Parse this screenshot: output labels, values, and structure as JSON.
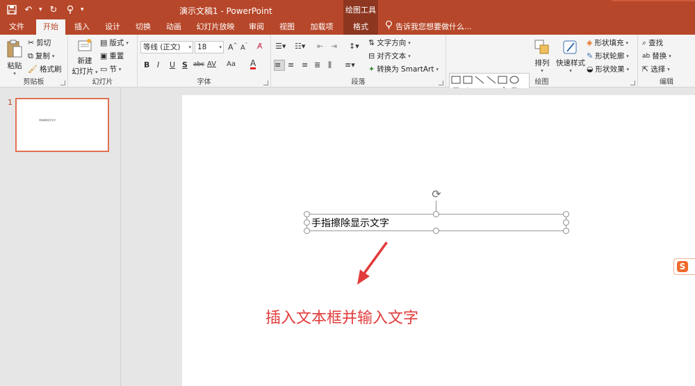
{
  "titlebar": {
    "doc_title": "演示文稿1 - PowerPoint",
    "context_title": "绘图工具",
    "qat": [
      "save-icon",
      "undo-icon",
      "redo-icon",
      "touch-mode-icon",
      "customize-icon"
    ]
  },
  "tabs": [
    {
      "label": "文件"
    },
    {
      "label": "开始"
    },
    {
      "label": "插入"
    },
    {
      "label": "设计"
    },
    {
      "label": "切换"
    },
    {
      "label": "动画"
    },
    {
      "label": "幻灯片放映"
    },
    {
      "label": "审阅"
    },
    {
      "label": "视图"
    },
    {
      "label": "加载项"
    },
    {
      "label": "格式"
    }
  ],
  "tellme": "告诉我您想要做什么...",
  "ribbon": {
    "clipboard": {
      "paste": "粘贴",
      "cut": "剪切",
      "copy": "复制",
      "format_painter": "格式刷",
      "label": "剪贴板"
    },
    "slides": {
      "new_slide_line1": "新建",
      "new_slide_line2": "幻灯片",
      "layout": "版式",
      "reset": "重置",
      "section": "节",
      "label": "幻灯片"
    },
    "font": {
      "font_name": "等线 (正文)",
      "font_size": "18",
      "label": "字体",
      "buttons": [
        "B",
        "I",
        "U",
        "S",
        "abc",
        "AV",
        "Aa",
        "A"
      ]
    },
    "paragraph": {
      "text_direction": "文字方向",
      "align_text": "对齐文本",
      "smartart": "转换为 SmartArt",
      "label": "段落"
    },
    "drawing": {
      "arrange": "排列",
      "quick_styles": "快速样式",
      "shape_fill": "形状填充",
      "shape_outline": "形状轮廓",
      "shape_effects": "形状效果",
      "label": "绘图"
    },
    "editing": {
      "find": "查找",
      "replace": "替换",
      "select": "选择",
      "label": "编辑"
    }
  },
  "slides_panel": {
    "slide_number": "1",
    "thumb_text": "手指擦除显示文字"
  },
  "slide": {
    "textbox_text": "手指擦除显示文字",
    "caption": "插入文本框并输入文字"
  },
  "colors": {
    "accent": "#b7472a",
    "caption": "#e23b3b"
  }
}
